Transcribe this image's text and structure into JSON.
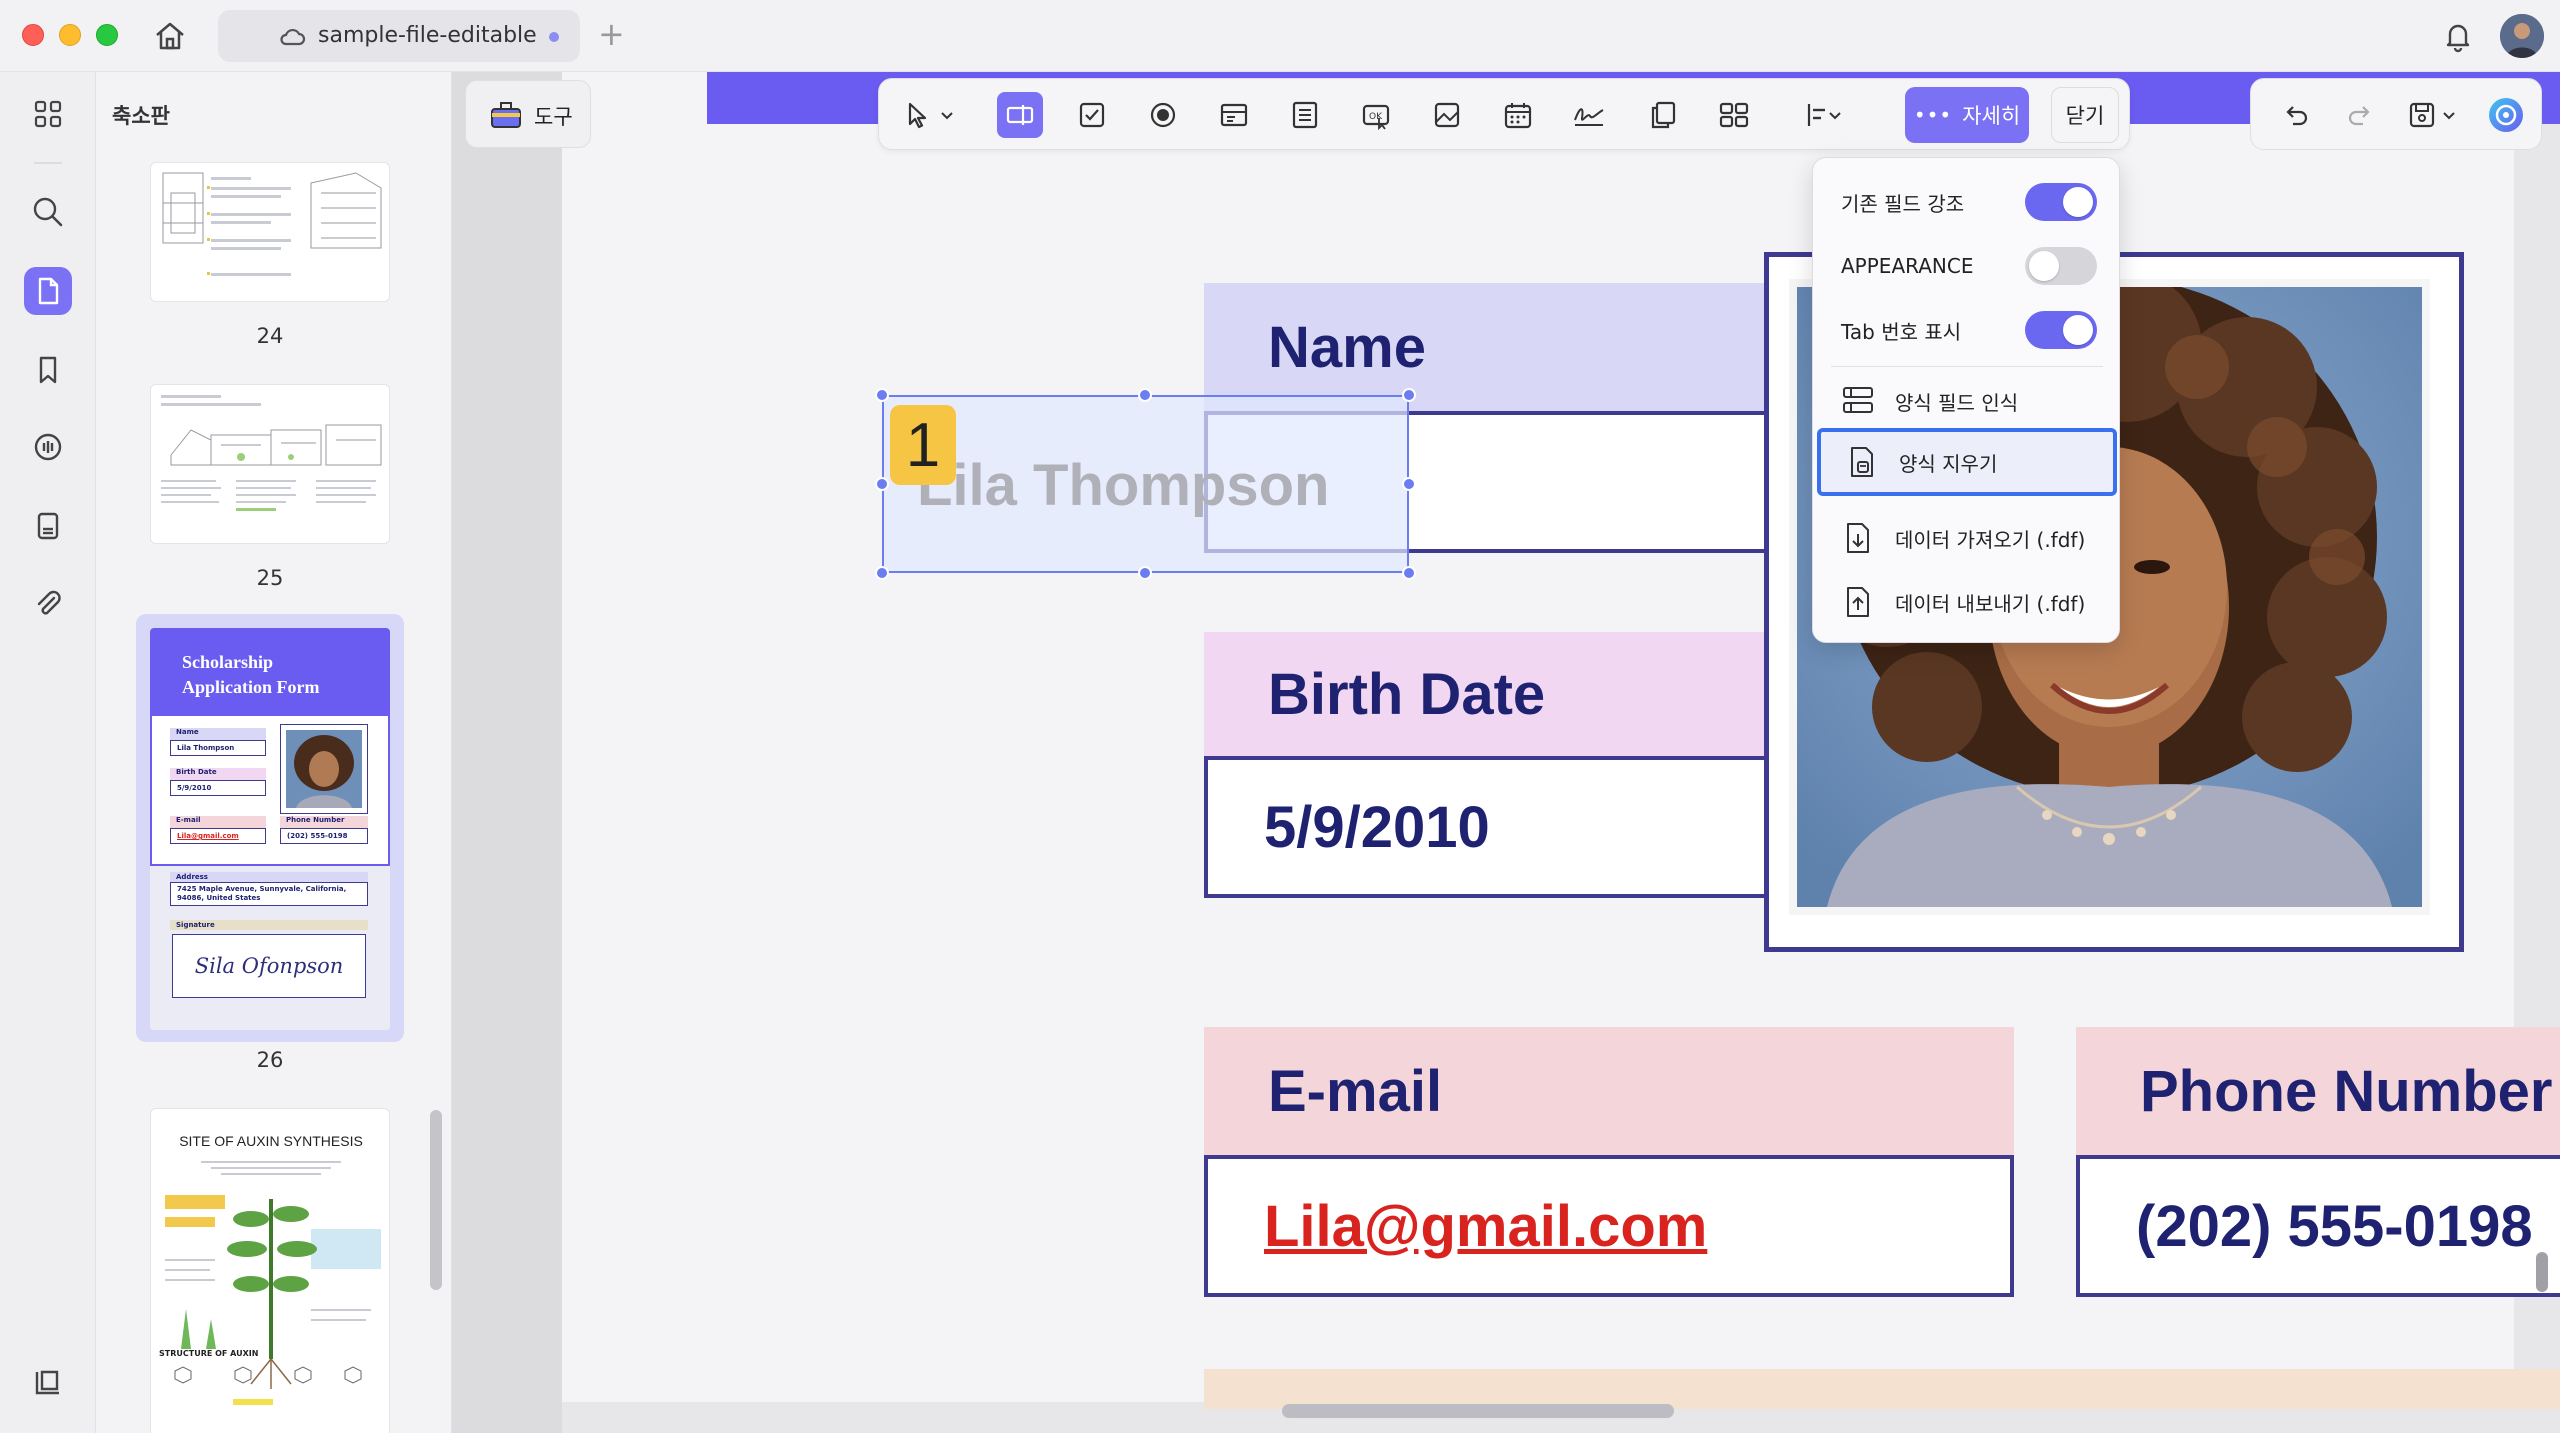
{
  "titlebar": {
    "tab_title": "sample-file-editable",
    "new_tab": "+"
  },
  "thumbnail_panel": {
    "title": "축소판",
    "pages": [
      "24",
      "25",
      "26"
    ],
    "thumb26": {
      "title": "Scholarship Application Form",
      "name_label": "Name",
      "name_value": "Lila Thompson",
      "birth_label": "Birth Date",
      "birth_value": "5/9/2010",
      "email_label": "E-mail",
      "email_value": "Lila@gmail.com",
      "phone_label": "Phone Number",
      "phone_value": "(202) 555-0198",
      "address_label": "Address",
      "address_value": "7425 Maple Avenue, Sunnyvale, California, 94086, United States",
      "signature_label": "Signature",
      "signature_value": "Sila Ofonpson"
    },
    "thumb27": {
      "title": "SITE OF AUXIN SYNTHESIS",
      "subtitle": "STRUCTURE OF AUXIN"
    }
  },
  "toolbar": {
    "tools_label": "도구",
    "more_label": "자세히",
    "close_label": "닫기"
  },
  "dropdown": {
    "items": [
      {
        "label": "기존 필드 강조",
        "toggle": true
      },
      {
        "label": "APPEARANCE",
        "toggle": false
      },
      {
        "label": "Tab 번호 표시",
        "toggle": true
      },
      {
        "label": "양식 필드 인식"
      },
      {
        "label": "양식 지우기"
      },
      {
        "label": "데이터 가져오기 (.fdf)"
      },
      {
        "label": "데이터 내보내기 (.fdf)"
      }
    ]
  },
  "form": {
    "name_label": "Name",
    "name_value": "Lila Thompson",
    "tab_number": "1",
    "birth_label": "Birth Date",
    "birth_value": "5/9/2010",
    "email_label": "E-mail",
    "email_value": "Lila@gmail.com",
    "phone_label": "Phone Number",
    "phone_value": "(202) 555-0198"
  },
  "colors": {
    "accent": "#7a71f5",
    "name_band": "#d8d8f6",
    "birth_band": "#f1d7f1",
    "email_band": "#f3d5da",
    "border": "#3d3a8f",
    "email_text": "#d9231f"
  }
}
